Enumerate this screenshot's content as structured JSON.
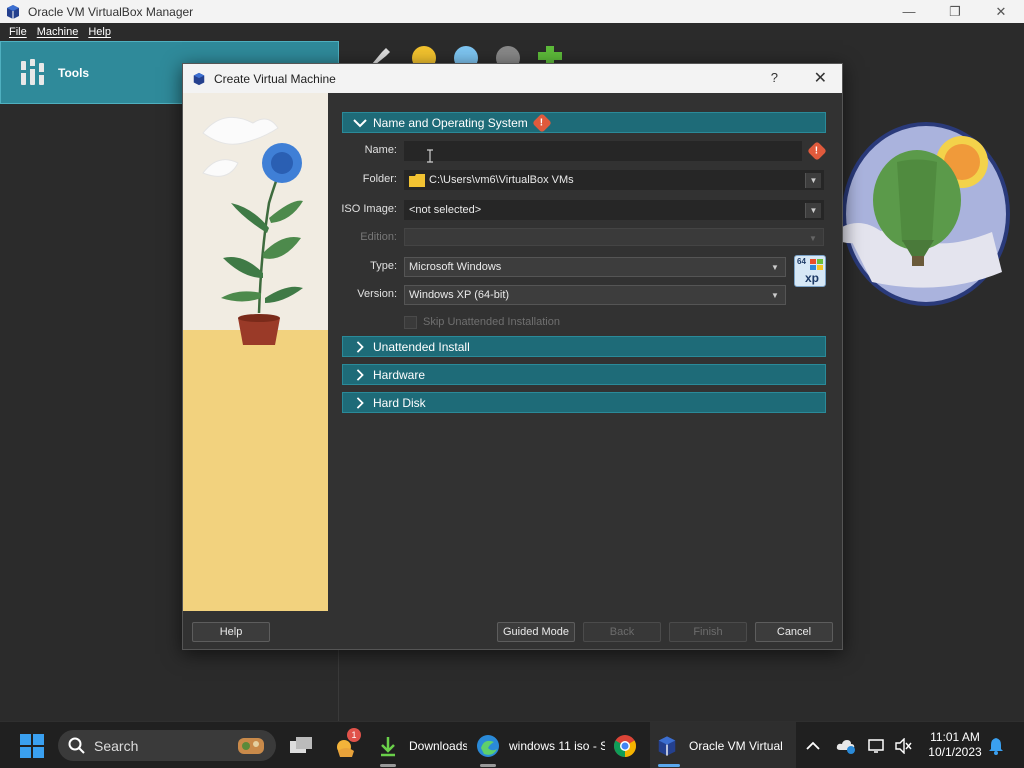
{
  "window": {
    "title": "Oracle VM VirtualBox Manager",
    "controls": {
      "minimize": "—",
      "restore": "❐",
      "close": "✕"
    }
  },
  "menubar": {
    "items": [
      "File",
      "Machine",
      "Help"
    ]
  },
  "sidebar": {
    "tools_label": "Tools"
  },
  "dialog": {
    "title": "Create Virtual Machine",
    "help_glyph": "?",
    "close_glyph": "✕",
    "sections": {
      "name_os": "Name and Operating System",
      "unattended": "Unattended Install",
      "hardware": "Hardware",
      "hard_disk": "Hard Disk"
    },
    "fields": {
      "name": {
        "label": "Name:",
        "value": ""
      },
      "folder": {
        "label": "Folder:",
        "value": "C:\\Users\\vm6\\VirtualBox VMs"
      },
      "iso": {
        "label": "ISO Image:",
        "value": "<not selected>"
      },
      "edition": {
        "label": "Edition:",
        "value": ""
      },
      "type": {
        "label": "Type:",
        "value": "Microsoft Windows"
      },
      "version": {
        "label": "Version:",
        "value": "Windows XP (64-bit)"
      },
      "skip_unattended": {
        "label": "Skip Unattended Installation",
        "checked": false
      }
    },
    "os_badge": {
      "bits": "64",
      "name": "xp"
    },
    "buttons": {
      "help": "Help",
      "guided": "Guided Mode",
      "back": "Back",
      "finish": "Finish",
      "cancel": "Cancel"
    }
  },
  "taskbar": {
    "search_placeholder": "Search",
    "downloads_label": "Downloads",
    "edge_label": "windows 11 iso - S",
    "vbox_label": "Oracle VM Virtual",
    "notification_badge": "1",
    "time": "11:01 AM",
    "date": "10/1/2023"
  },
  "colors": {
    "section_header": "#1e6b78",
    "tools_highlight": "#2f8a9a",
    "warning": "#e05a3c"
  }
}
